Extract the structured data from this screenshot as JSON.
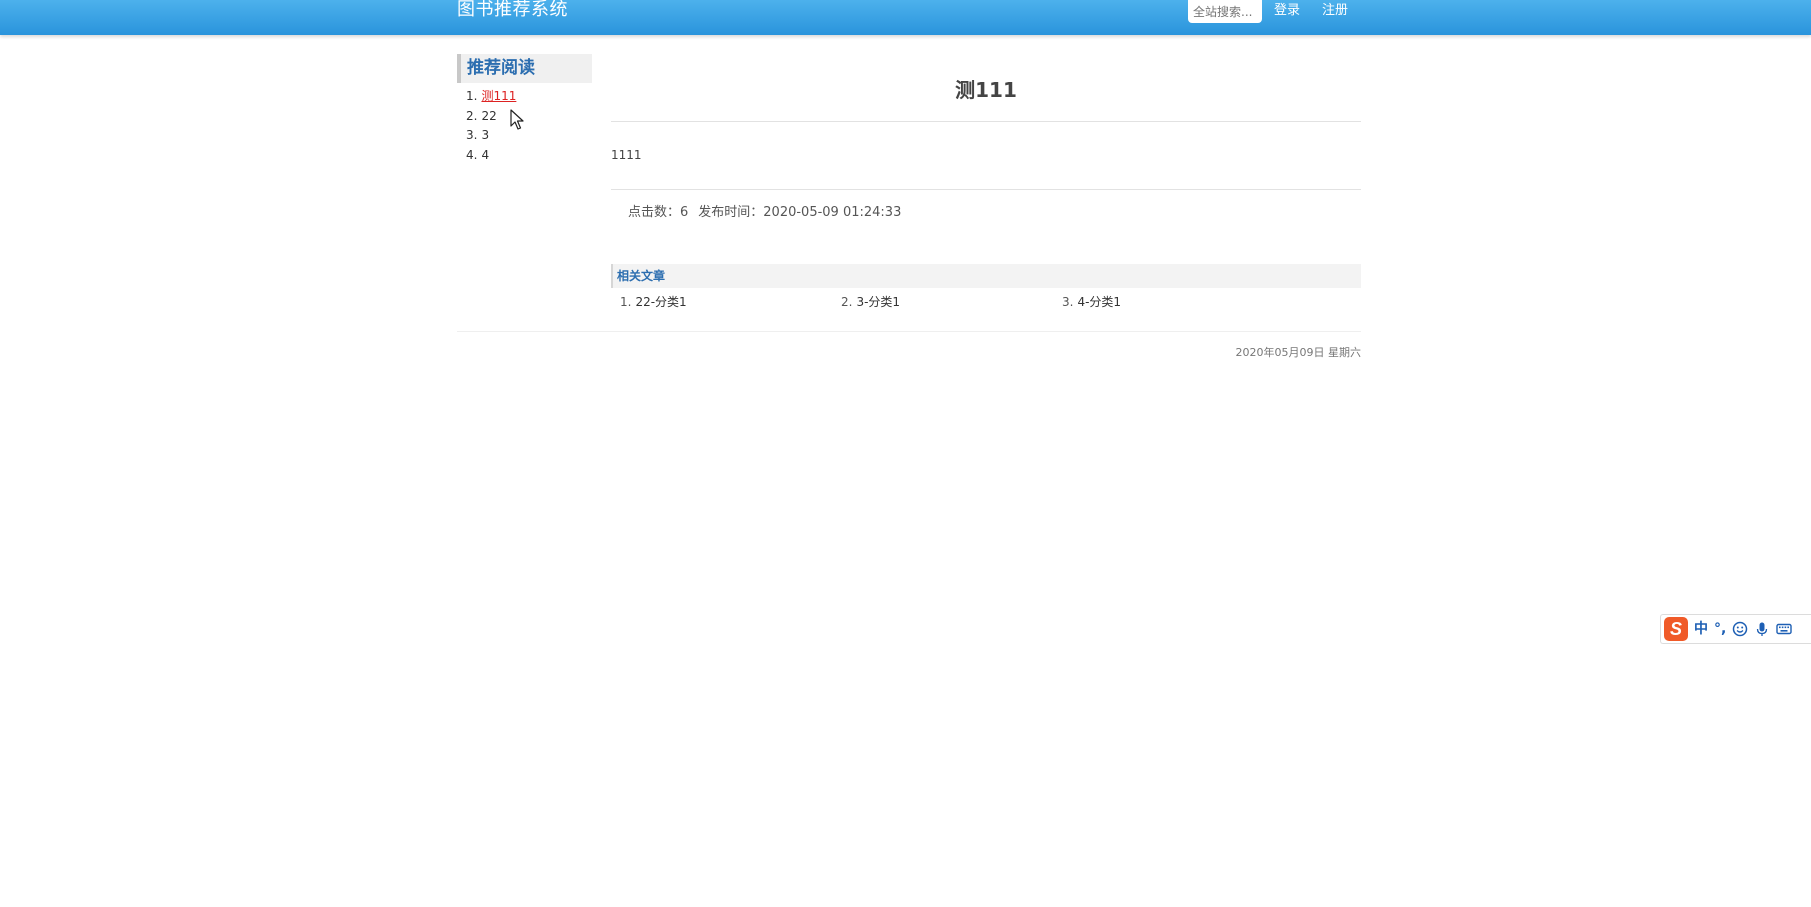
{
  "header": {
    "brand": "图书推荐系统",
    "search_placeholder": "全站搜索...",
    "login_label": "登录",
    "register_label": "注册",
    "gradient_top": "#4db1ec",
    "gradient_bottom": "#2a94dc"
  },
  "sidebar": {
    "title": "推荐阅读",
    "items": [
      {
        "num": "1.",
        "label": "测111"
      },
      {
        "num": "2.",
        "label": "22"
      },
      {
        "num": "3.",
        "label": "3"
      },
      {
        "num": "4.",
        "label": "4"
      }
    ]
  },
  "article": {
    "title": "测111",
    "body": "1111",
    "clicks": "点击数：6",
    "publish_time": "发布时间：2020-05-09 01:24:33"
  },
  "related": {
    "title": "相关文章",
    "items": [
      {
        "num": "1.",
        "label": "22-分类1"
      },
      {
        "num": "2.",
        "label": "3-分类1"
      },
      {
        "num": "3.",
        "label": "4-分类1"
      }
    ]
  },
  "footer": {
    "date": "2020年05月09日 星期六"
  },
  "ime": {
    "logo": "S",
    "mode": "中",
    "punct": "°,",
    "icons": [
      "smiley-icon",
      "microphone-icon",
      "keyboard-icon"
    ]
  }
}
